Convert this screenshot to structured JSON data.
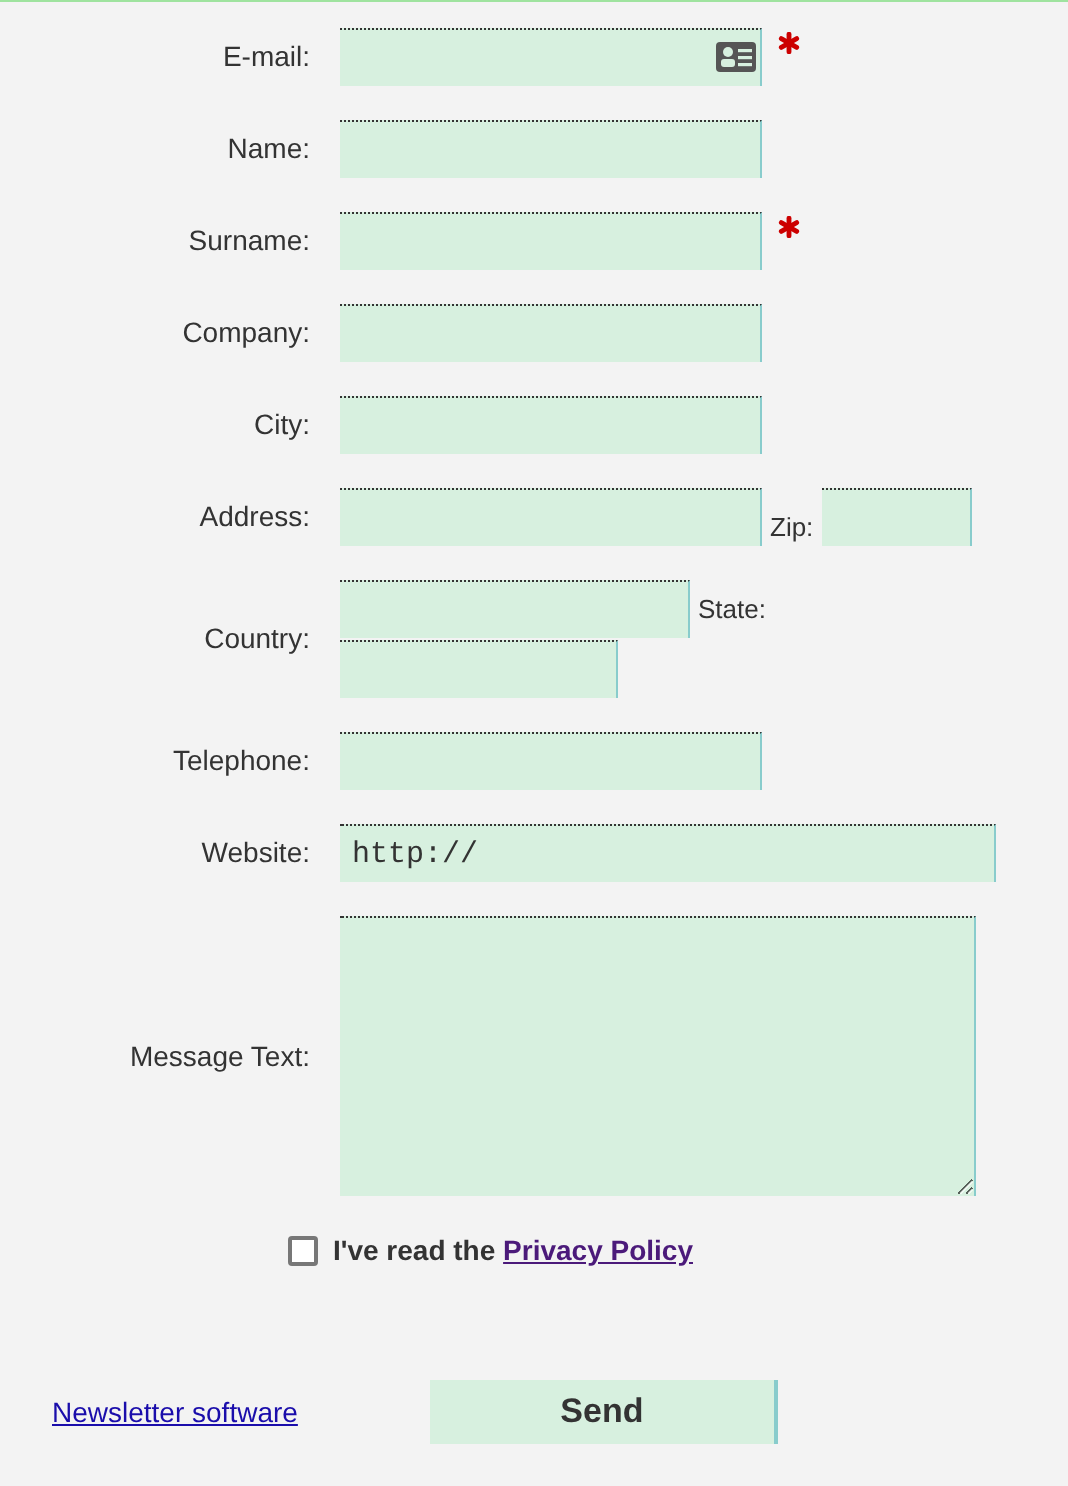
{
  "fields": [
    {
      "label": "E-mail:",
      "kind": "email",
      "required": true
    },
    {
      "label": "Name:",
      "kind": "text",
      "required": false
    },
    {
      "label": "Surname:",
      "kind": "text",
      "required": true
    },
    {
      "label": "Company:",
      "kind": "text",
      "required": false
    },
    {
      "label": "City:",
      "kind": "text",
      "required": false
    },
    {
      "label": "Address:",
      "kind": "address",
      "required": false,
      "extra_label": "Zip:"
    },
    {
      "label": "Country:",
      "kind": "country",
      "required": false,
      "extra_label": "State:"
    },
    {
      "label": "Telephone:",
      "kind": "text",
      "required": false
    },
    {
      "label": "Website:",
      "kind": "website",
      "required": false,
      "value": "http://"
    },
    {
      "label": "Message Text:",
      "kind": "message",
      "required": false
    }
  ],
  "consent": {
    "checked": false,
    "text": "I've read the",
    "link": "Privacy Policy"
  },
  "footer_link": "Newsletter software",
  "send_button": "Send"
}
